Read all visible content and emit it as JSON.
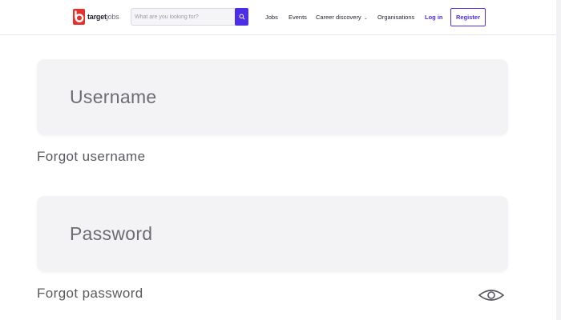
{
  "header": {
    "logo_text_bold": "target",
    "logo_text_light": "jobs",
    "search_placeholder": "What are you looking for?",
    "nav": {
      "jobs": "Jobs",
      "events": "Events",
      "career": "Career discovery",
      "orgs": "Organisations",
      "login": "Log in",
      "register": "Register"
    }
  },
  "form": {
    "username_placeholder": "Username",
    "forgot_username": "Forgot username",
    "password_placeholder": "Password",
    "forgot_password": "Forgot password"
  },
  "colors": {
    "accent": "#4b2ee6",
    "logo_red": "#e4312b",
    "field_bg": "#f3f3f6"
  },
  "icons": [
    "logo-mark",
    "search-icon",
    "chevron-down-icon",
    "eye-icon"
  ]
}
